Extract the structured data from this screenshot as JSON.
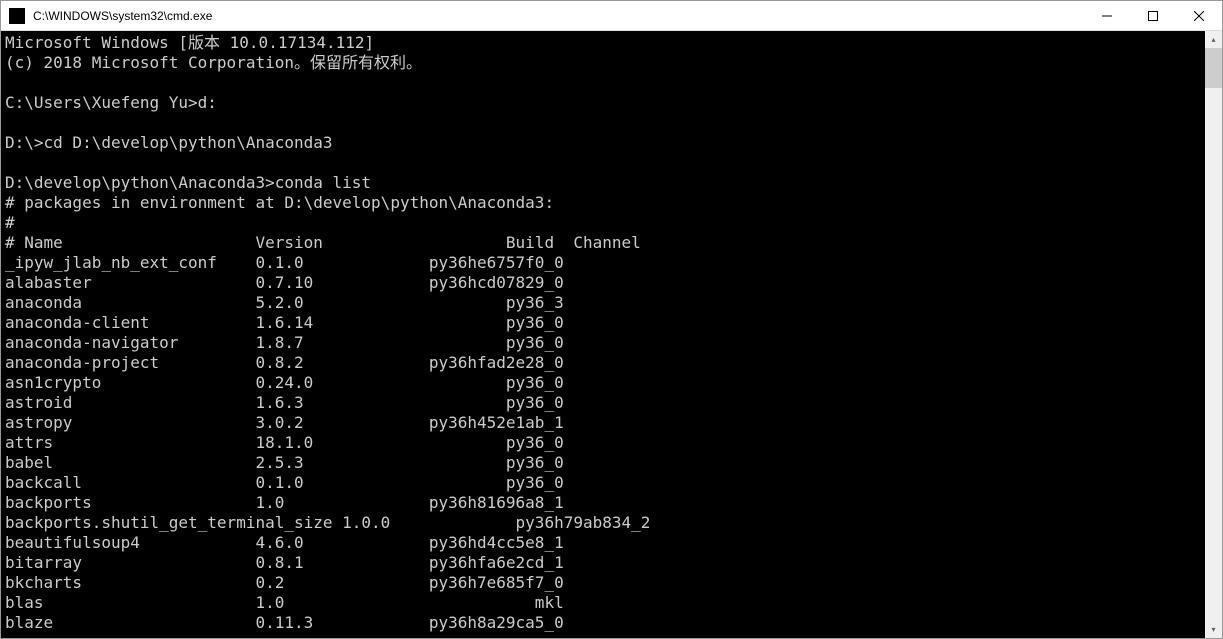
{
  "window": {
    "title": "C:\\WINDOWS\\system32\\cmd.exe"
  },
  "terminal": {
    "header1": "Microsoft Windows [版本 10.0.17134.112]",
    "header2": "(c) 2018 Microsoft Corporation。保留所有权利。",
    "prompt1": "C:\\Users\\Xuefeng Yu>d:",
    "prompt2": "D:\\>cd D:\\develop\\python\\Anaconda3",
    "prompt3": "D:\\develop\\python\\Anaconda3>conda list",
    "env_line": "# packages in environment at D:\\develop\\python\\Anaconda3:",
    "hash_line": "#",
    "columns": "# Name                    Version                   Build  Channel",
    "packages": [
      {
        "name": "_ipyw_jlab_nb_ext_conf",
        "version": "0.1.0",
        "build": "py36he6757f0_0"
      },
      {
        "name": "alabaster",
        "version": "0.7.10",
        "build": "py36hcd07829_0"
      },
      {
        "name": "anaconda",
        "version": "5.2.0",
        "build": "py36_3"
      },
      {
        "name": "anaconda-client",
        "version": "1.6.14",
        "build": "py36_0"
      },
      {
        "name": "anaconda-navigator",
        "version": "1.8.7",
        "build": "py36_0"
      },
      {
        "name": "anaconda-project",
        "version": "0.8.2",
        "build": "py36hfad2e28_0"
      },
      {
        "name": "asn1crypto",
        "version": "0.24.0",
        "build": "py36_0"
      },
      {
        "name": "astroid",
        "version": "1.6.3",
        "build": "py36_0"
      },
      {
        "name": "astropy",
        "version": "3.0.2",
        "build": "py36h452e1ab_1"
      },
      {
        "name": "attrs",
        "version": "18.1.0",
        "build": "py36_0"
      },
      {
        "name": "babel",
        "version": "2.5.3",
        "build": "py36_0"
      },
      {
        "name": "backcall",
        "version": "0.1.0",
        "build": "py36_0"
      },
      {
        "name": "backports",
        "version": "1.0",
        "build": "py36h81696a8_1"
      },
      {
        "name": "backports.shutil_get_terminal_size",
        "version": "1.0.0",
        "build": "py36h79ab834_2"
      },
      {
        "name": "beautifulsoup4",
        "version": "4.6.0",
        "build": "py36hd4cc5e8_1"
      },
      {
        "name": "bitarray",
        "version": "0.8.1",
        "build": "py36hfa6e2cd_1"
      },
      {
        "name": "bkcharts",
        "version": "0.2",
        "build": "py36h7e685f7_0"
      },
      {
        "name": "blas",
        "version": "1.0",
        "build": "mkl"
      },
      {
        "name": "blaze",
        "version": "0.11.3",
        "build": "py36h8a29ca5_0"
      }
    ]
  }
}
